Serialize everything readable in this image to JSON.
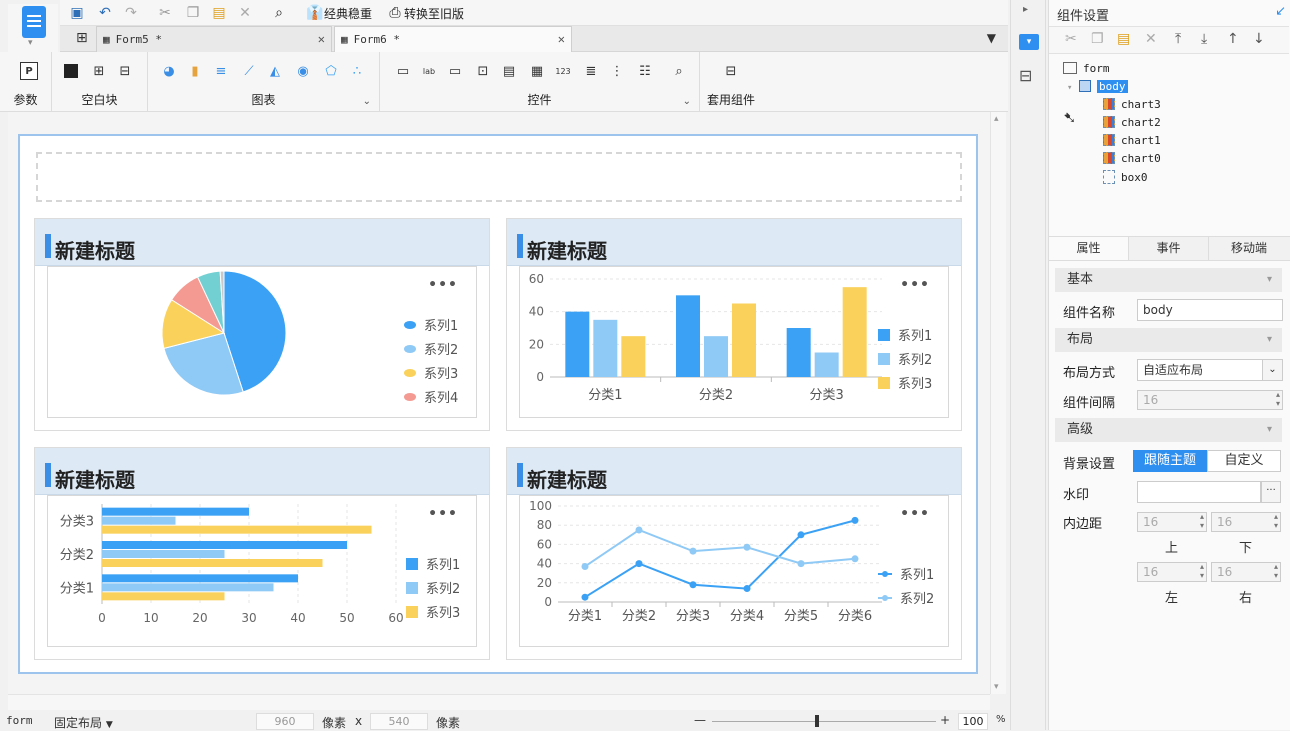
{
  "toolbar": {
    "classic_label": "经典稳重",
    "convert_label": "转换至旧版"
  },
  "tabs": [
    {
      "label": "Form5 *"
    },
    {
      "label": "Form6 *"
    }
  ],
  "ribbon": {
    "params": "参数",
    "blank": "空白块",
    "charts": "图表",
    "controls": "控件",
    "templates": "套用组件"
  },
  "panels": [
    {
      "title": "新建标题"
    },
    {
      "title": "新建标题"
    },
    {
      "title": "新建标题"
    },
    {
      "title": "新建标题"
    }
  ],
  "chart_data": [
    {
      "type": "pie",
      "title": "新建标题",
      "categories": [
        "系列1",
        "系列2",
        "系列3",
        "系列4"
      ],
      "values": [
        45,
        26,
        13,
        9,
        6,
        1
      ],
      "legend": [
        "系列1",
        "系列2",
        "系列3",
        "系列4"
      ],
      "legend_position": "right",
      "colors": [
        "#3aa1f5",
        "#8fc9f5",
        "#f9d15b",
        "#f49a92",
        "#73d0d2",
        "#c9c9c9"
      ]
    },
    {
      "type": "bar",
      "title": "新建标题",
      "categories": [
        "分类1",
        "分类2",
        "分类3"
      ],
      "series": [
        {
          "name": "系列1",
          "values": [
            40,
            50,
            30
          ]
        },
        {
          "name": "系列2",
          "values": [
            35,
            25,
            15
          ]
        },
        {
          "name": "系列3",
          "values": [
            25,
            45,
            55
          ]
        }
      ],
      "ylim": [
        0,
        60
      ],
      "yticks": [
        0,
        20,
        40,
        60
      ],
      "legend_position": "right",
      "colors": [
        "#3aa1f5",
        "#8fc9f5",
        "#f9d15b"
      ]
    },
    {
      "type": "bar",
      "orientation": "horizontal",
      "title": "新建标题",
      "categories": [
        "分类1",
        "分类2",
        "分类3"
      ],
      "series": [
        {
          "name": "系列1",
          "values": [
            40,
            50,
            30
          ]
        },
        {
          "name": "系列2",
          "values": [
            35,
            25,
            15
          ]
        },
        {
          "name": "系列3",
          "values": [
            25,
            45,
            55
          ]
        }
      ],
      "xlim": [
        0,
        60
      ],
      "xticks": [
        0,
        10,
        20,
        30,
        40,
        50,
        60
      ],
      "legend_position": "right",
      "colors": [
        "#3aa1f5",
        "#8fc9f5",
        "#f9d15b"
      ]
    },
    {
      "type": "line",
      "title": "新建标题",
      "categories": [
        "分类1",
        "分类2",
        "分类3",
        "分类4",
        "分类5",
        "分类6"
      ],
      "series": [
        {
          "name": "系列1",
          "values": [
            5,
            40,
            18,
            14,
            70,
            85
          ]
        },
        {
          "name": "系列2",
          "values": [
            37,
            75,
            53,
            57,
            40,
            45
          ]
        }
      ],
      "ylim": [
        0,
        100
      ],
      "yticks": [
        0,
        20,
        40,
        60,
        80,
        100
      ],
      "legend_position": "right",
      "colors": [
        "#3aa1f5",
        "#8fc9f5"
      ]
    }
  ],
  "status": {
    "mode": "form",
    "layout": "固定布局",
    "width": "960",
    "unit1": "像素",
    "x": "x",
    "height": "540",
    "unit2": "像素",
    "minus": "—",
    "plus": "+",
    "zoom": "100",
    "pct": "%"
  },
  "right_panel": {
    "title": "组件设置",
    "tree": {
      "form": "form",
      "body": "body",
      "children": [
        "chart3",
        "chart2",
        "chart1",
        "chart0",
        "box0"
      ]
    },
    "tabs": [
      "属性",
      "事件",
      "移动端"
    ],
    "basic": "基本",
    "name_label": "组件名称",
    "name_value": "body",
    "layout_section": "布局",
    "layout_mode_label": "布局方式",
    "layout_mode_value": "自适应布局",
    "gap_label": "组件间隔",
    "gap_value": "16",
    "advanced": "高级",
    "bg_label": "背景设置",
    "bg_follow": "跟随主题",
    "bg_custom": "自定义",
    "watermark_label": "水印",
    "padding_label": "内边距",
    "pad_top": "16",
    "pad_bottom": "16",
    "pad_left": "16",
    "pad_right": "16",
    "top": "上",
    "bottom": "下",
    "left": "左",
    "right": "右"
  }
}
